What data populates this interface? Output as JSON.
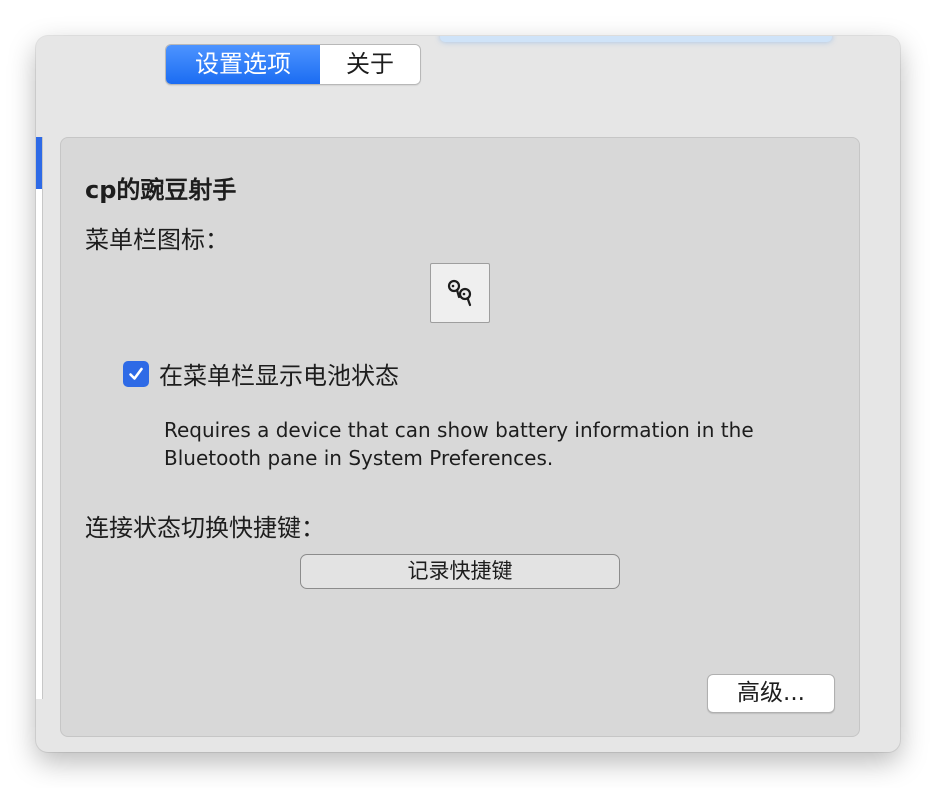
{
  "tabs": [
    {
      "label": "设置选项",
      "active": true
    },
    {
      "label": "关于",
      "active": false
    }
  ],
  "panel": {
    "device_name": "cp的豌豆射手",
    "menubar_icon_label": "菜单栏图标：",
    "menubar_icon": "airpods-icon",
    "battery_checkbox": {
      "label": "在菜单栏显示电池状态",
      "checked": true
    },
    "battery_hint": "Requires a device that can show battery information in the Bluetooth pane in System Preferences.",
    "shortcut_label": "连接状态切换快捷键：",
    "record_shortcut_button": "记录快捷键",
    "advanced_button": "高级..."
  },
  "colors": {
    "accent": "#2e6ae6",
    "tab_active_top": "#4d94ff",
    "panel_background": "#d8d8d8",
    "window_background": "#e6e6e6"
  }
}
